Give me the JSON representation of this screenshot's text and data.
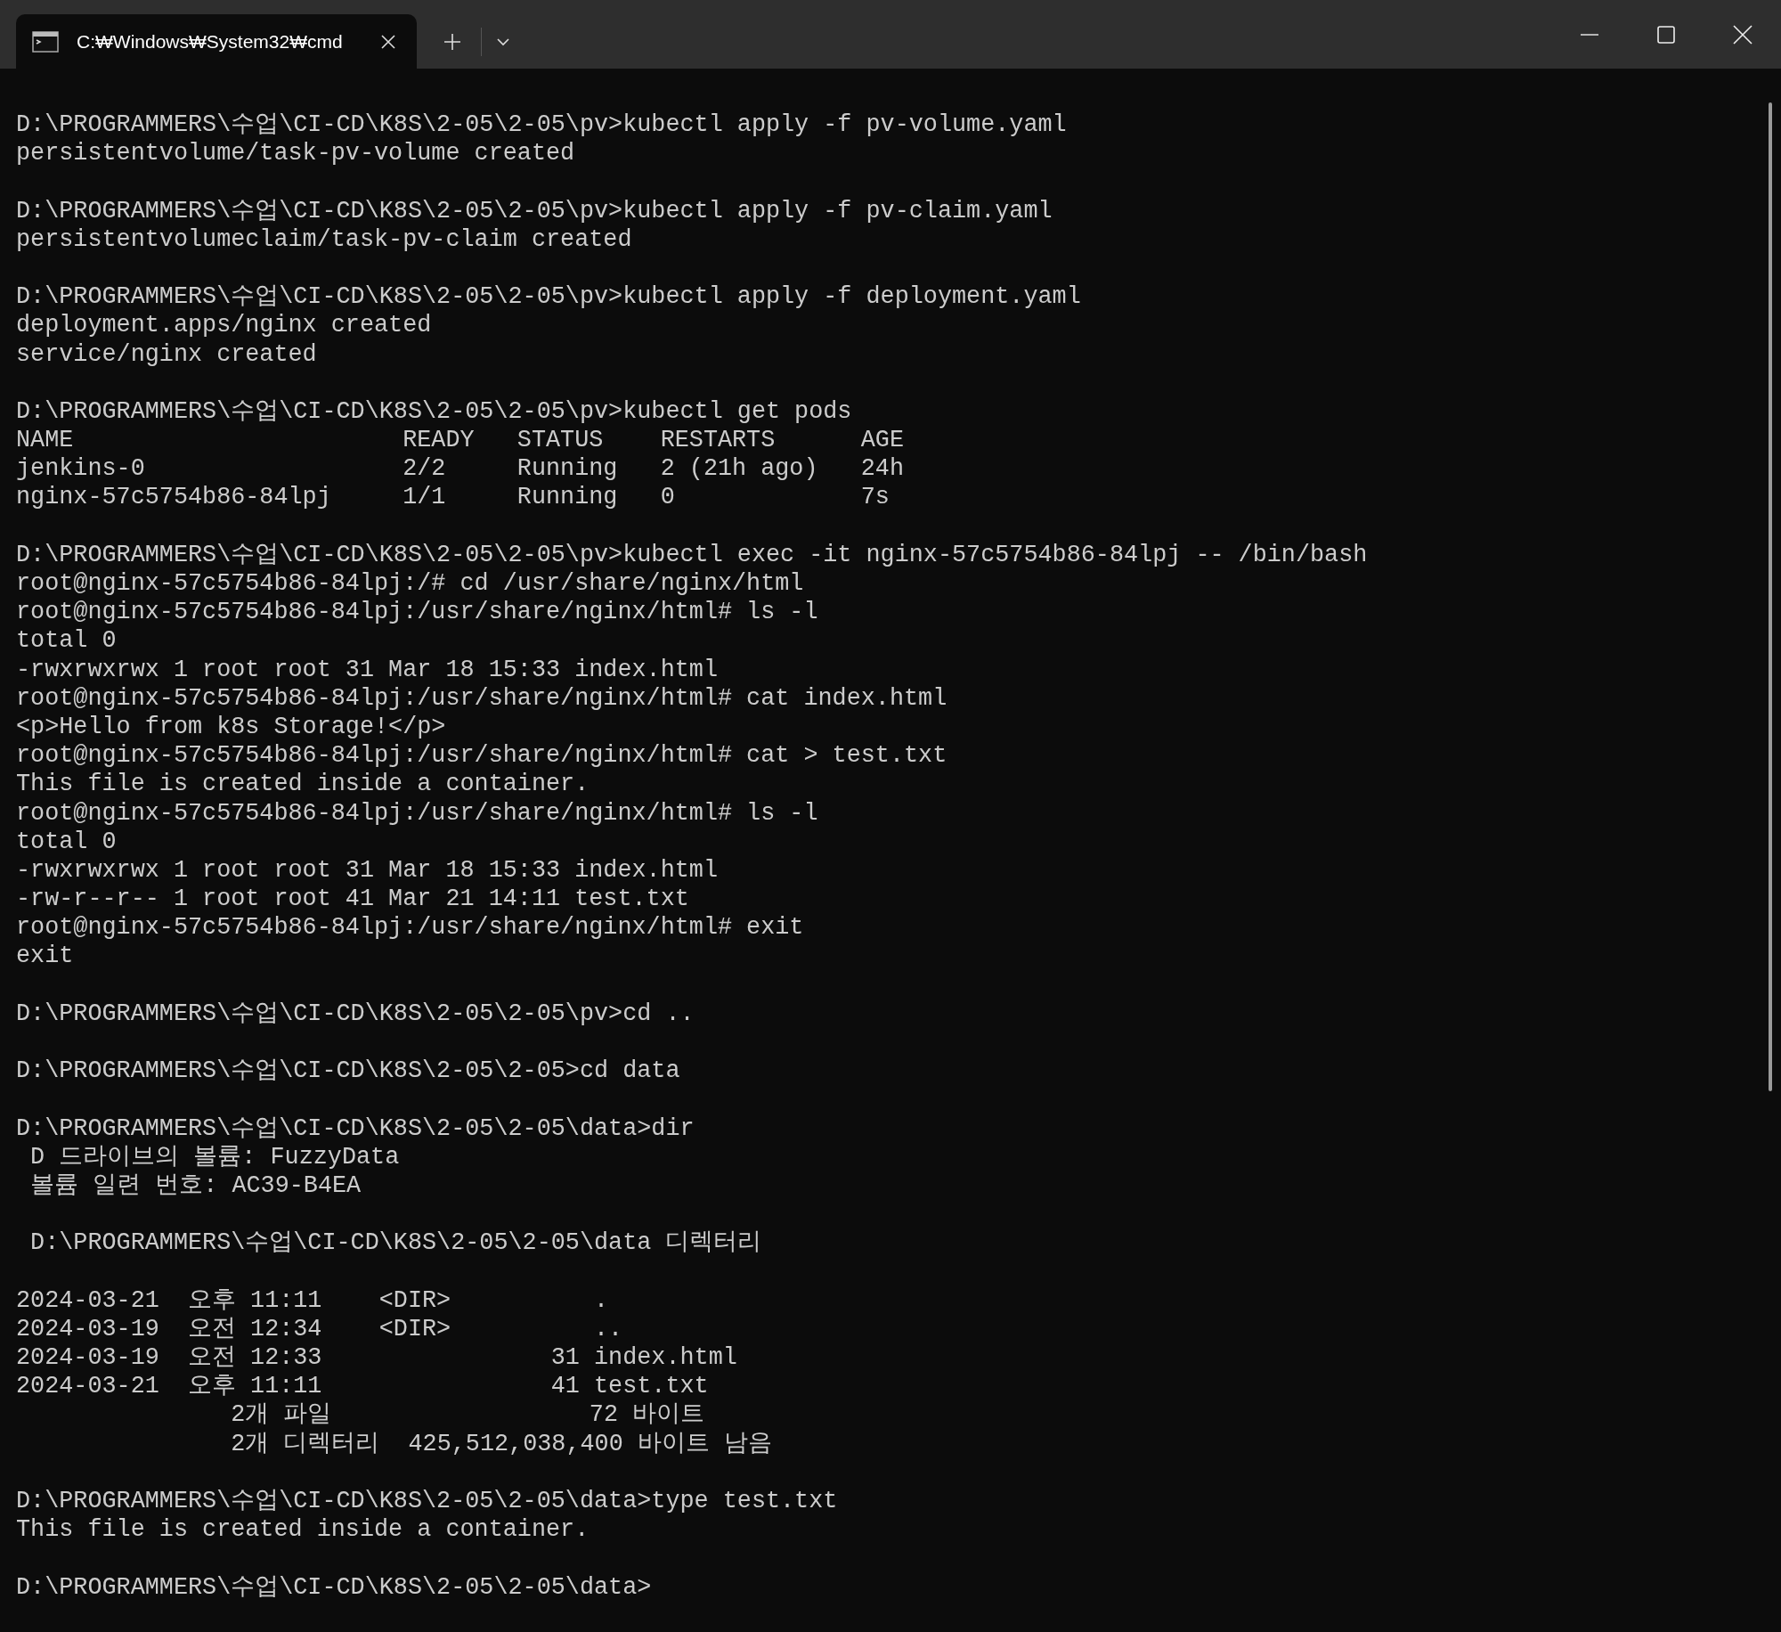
{
  "tab": {
    "title": "C:₩Windows₩System32₩cmd",
    "selected": true
  },
  "blocks": [
    [
      "D:\\PROGRAMMERS\\수업\\CI-CD\\K8S\\2-05\\2-05\\pv>kubectl apply -f pv-volume.yaml",
      "persistentvolume/task-pv-volume created"
    ],
    [
      "D:\\PROGRAMMERS\\수업\\CI-CD\\K8S\\2-05\\2-05\\pv>kubectl apply -f pv-claim.yaml",
      "persistentvolumeclaim/task-pv-claim created"
    ],
    [
      "D:\\PROGRAMMERS\\수업\\CI-CD\\K8S\\2-05\\2-05\\pv>kubectl apply -f deployment.yaml",
      "deployment.apps/nginx created",
      "service/nginx created"
    ],
    [
      "D:\\PROGRAMMERS\\수업\\CI-CD\\K8S\\2-05\\2-05\\pv>kubectl get pods",
      "NAME                       READY   STATUS    RESTARTS      AGE",
      "jenkins-0                  2/2     Running   2 (21h ago)   24h",
      "nginx-57c5754b86-84lpj     1/1     Running   0             7s"
    ],
    [
      "D:\\PROGRAMMERS\\수업\\CI-CD\\K8S\\2-05\\2-05\\pv>kubectl exec -it nginx-57c5754b86-84lpj -- /bin/bash",
      "root@nginx-57c5754b86-84lpj:/# cd /usr/share/nginx/html",
      "root@nginx-57c5754b86-84lpj:/usr/share/nginx/html# ls -l",
      "total 0",
      "-rwxrwxrwx 1 root root 31 Mar 18 15:33 index.html",
      "root@nginx-57c5754b86-84lpj:/usr/share/nginx/html# cat index.html",
      "<p>Hello from k8s Storage!</p>",
      "root@nginx-57c5754b86-84lpj:/usr/share/nginx/html# cat > test.txt",
      "This file is created inside a container.",
      "root@nginx-57c5754b86-84lpj:/usr/share/nginx/html# ls -l",
      "total 0",
      "-rwxrwxrwx 1 root root 31 Mar 18 15:33 index.html",
      "-rw-r--r-- 1 root root 41 Mar 21 14:11 test.txt",
      "root@nginx-57c5754b86-84lpj:/usr/share/nginx/html# exit",
      "exit"
    ],
    [
      "D:\\PROGRAMMERS\\수업\\CI-CD\\K8S\\2-05\\2-05\\pv>cd .."
    ],
    [
      "D:\\PROGRAMMERS\\수업\\CI-CD\\K8S\\2-05\\2-05>cd data"
    ],
    [
      "D:\\PROGRAMMERS\\수업\\CI-CD\\K8S\\2-05\\2-05\\data>dir",
      " D 드라이브의 볼륨: FuzzyData",
      " 볼륨 일련 번호: AC39-B4EA"
    ],
    [
      " D:\\PROGRAMMERS\\수업\\CI-CD\\K8S\\2-05\\2-05\\data 디렉터리"
    ],
    [
      "2024-03-21  오후 11:11    <DIR>          .",
      "2024-03-19  오전 12:34    <DIR>          ..",
      "2024-03-19  오전 12:33                31 index.html",
      "2024-03-21  오후 11:11                41 test.txt",
      "               2개 파일                  72 바이트",
      "               2개 디렉터리  425,512,038,400 바이트 남음"
    ],
    [
      "D:\\PROGRAMMERS\\수업\\CI-CD\\K8S\\2-05\\2-05\\data>type test.txt",
      "This file is created inside a container."
    ],
    [
      "D:\\PROGRAMMERS\\수업\\CI-CD\\K8S\\2-05\\2-05\\data>"
    ]
  ]
}
